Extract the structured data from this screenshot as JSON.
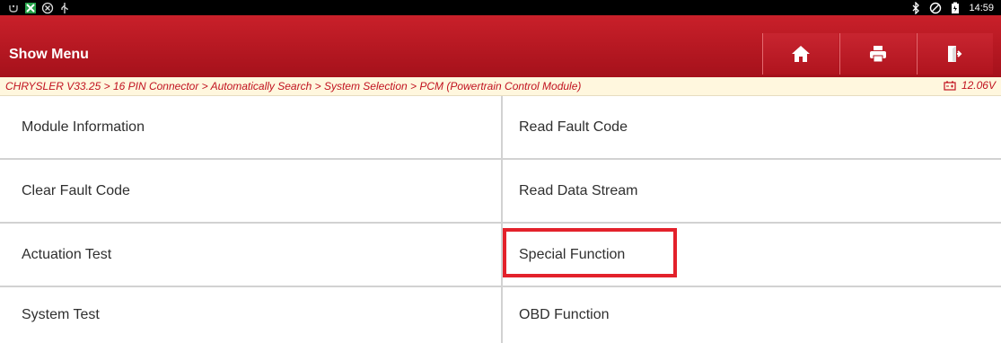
{
  "status_bar": {
    "time": "14:59",
    "icons_left": [
      "usb-debug-icon",
      "app-icon",
      "settings-icon",
      "usb-icon"
    ],
    "icons_right": [
      "bluetooth-icon",
      "do-not-disturb-icon",
      "battery-icon"
    ]
  },
  "header": {
    "title": "Show Menu",
    "buttons": [
      {
        "name": "home",
        "icon": "home-icon"
      },
      {
        "name": "print",
        "icon": "printer-icon"
      },
      {
        "name": "exit",
        "icon": "exit-icon"
      }
    ]
  },
  "breadcrumb": "CHRYSLER V33.25 > 16 PIN Connector > Automatically Search > System Selection > PCM (Powertrain Control Module)",
  "voltage": "12.06V",
  "menu": [
    {
      "label": "Module Information"
    },
    {
      "label": "Read Fault Code"
    },
    {
      "label": "Clear Fault Code"
    },
    {
      "label": "Read Data Stream"
    },
    {
      "label": "Actuation Test"
    },
    {
      "label": "Special Function",
      "highlighted": true
    },
    {
      "label": "System Test"
    },
    {
      "label": "OBD Function"
    }
  ],
  "colors": {
    "header": "#b3151f",
    "breadcrumb_text": "#c1121f",
    "highlight": "#e3212b"
  }
}
